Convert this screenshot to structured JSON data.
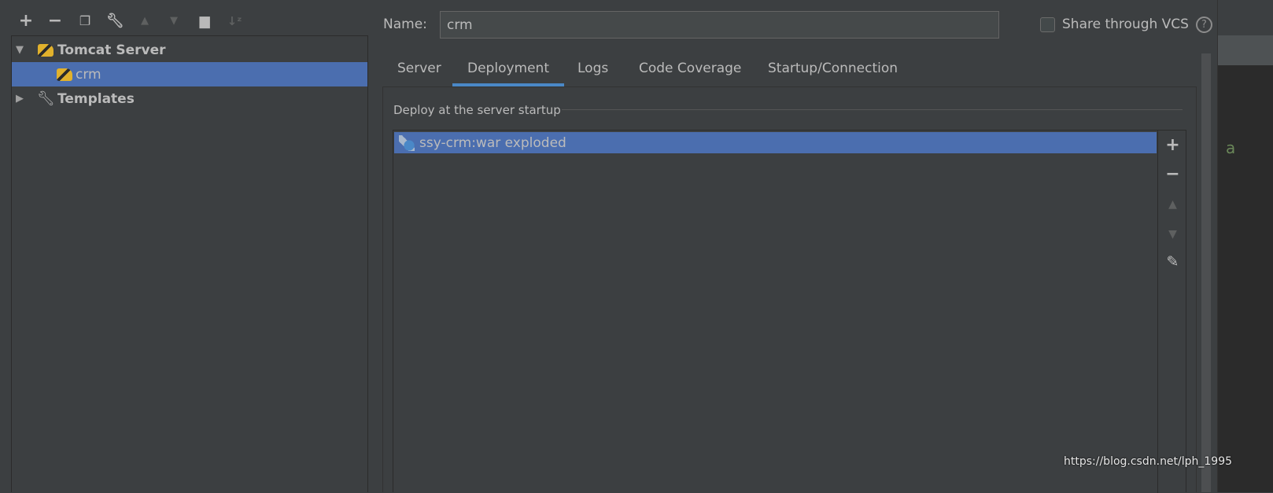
{
  "toolbar": {
    "icons": [
      "plus-icon",
      "minus-icon",
      "copy-icon",
      "wrench-icon",
      "arrow-up-icon",
      "arrow-down-icon",
      "new-folder-icon",
      "sort-icon"
    ]
  },
  "tree": {
    "group": "Tomcat Server",
    "child": "crm",
    "templates": "Templates"
  },
  "form": {
    "name_label": "Name:",
    "name_value": "crm",
    "share_label": "Share through VCS",
    "share_checked": false
  },
  "tabs": [
    {
      "label": "Server"
    },
    {
      "label": "Deployment",
      "active": true
    },
    {
      "label": "Logs"
    },
    {
      "label": "Code Coverage"
    },
    {
      "label": "Startup/Connection"
    }
  ],
  "deployment": {
    "section_title": "Deploy at the server startup",
    "artifacts": [
      "ssy-crm:war exploded"
    ]
  },
  "watermark": "https://blog.csdn.net/lph_1995",
  "edge_char": "a",
  "colors": {
    "selection": "#4b6eaf",
    "tab_underline": "#4a88c7",
    "background": "#3c3f41"
  }
}
